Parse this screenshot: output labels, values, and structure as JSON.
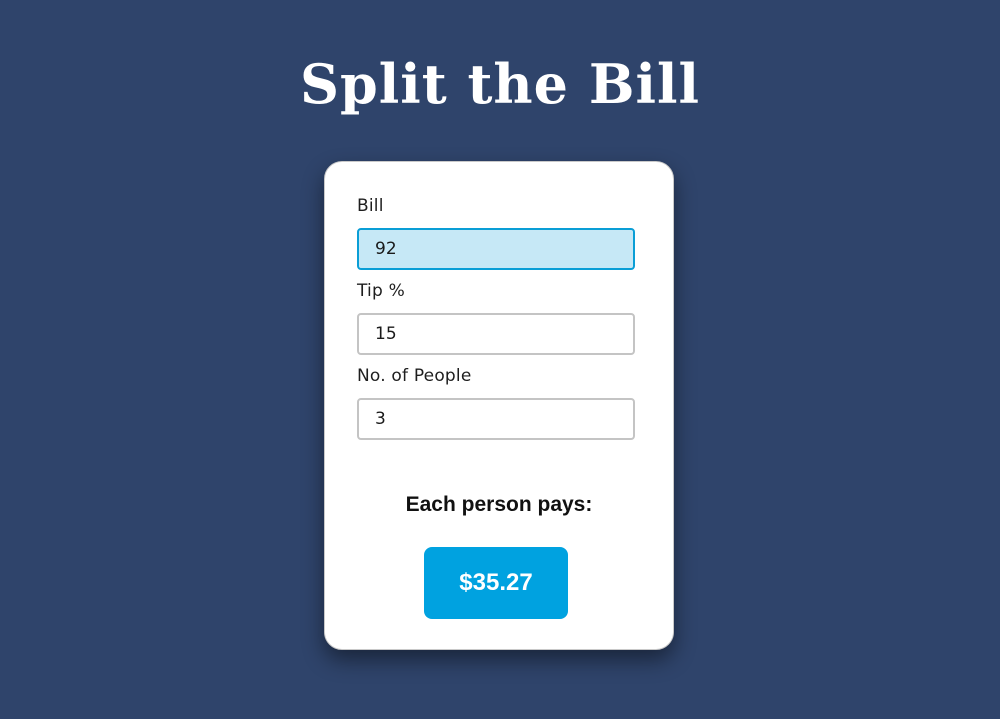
{
  "page": {
    "title": "Split the Bill",
    "background_color": "#2f446b"
  },
  "form": {
    "bill": {
      "label": "Bill",
      "value": "92"
    },
    "tip": {
      "label": "Tip %",
      "value": "15"
    },
    "people": {
      "label": "No. of People",
      "value": "3"
    }
  },
  "result": {
    "label": "Each person pays:",
    "amount": "$35.27",
    "accent_color": "#00a2e0"
  }
}
